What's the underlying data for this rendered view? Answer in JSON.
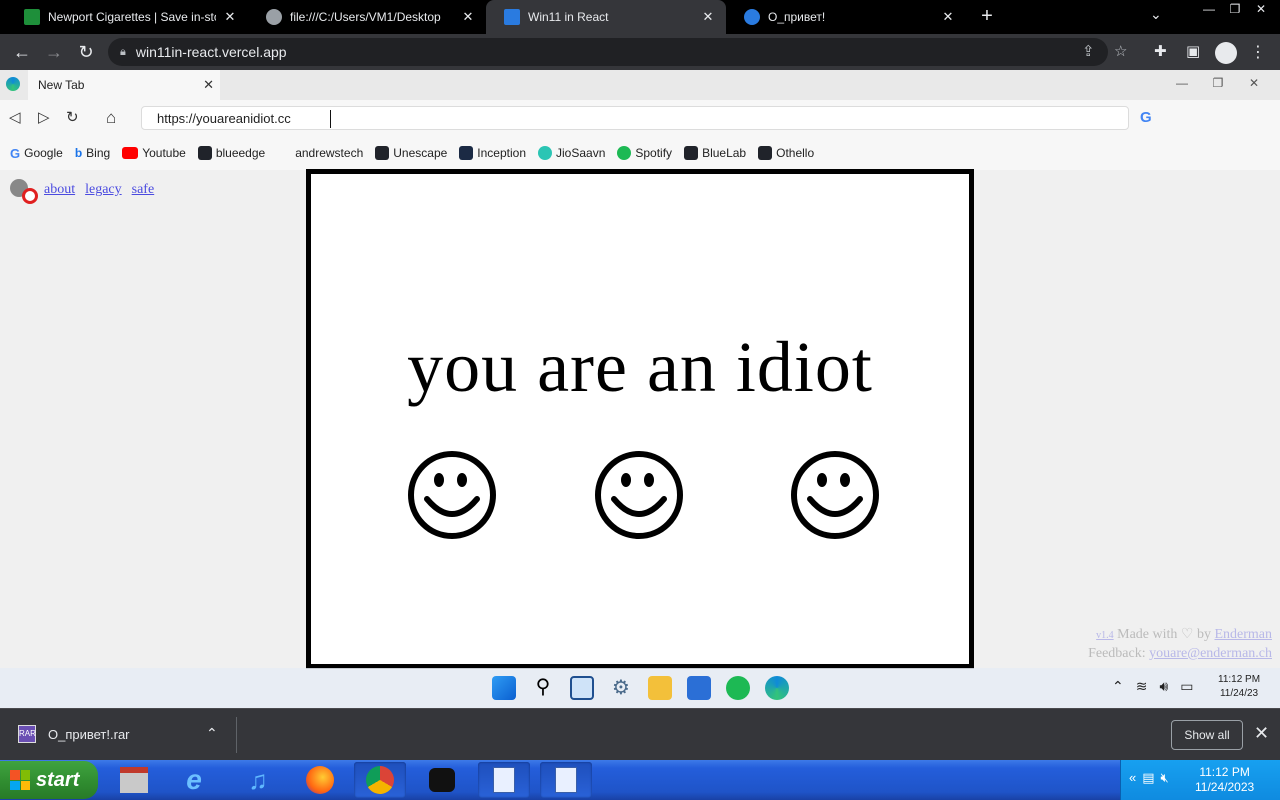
{
  "outer_tabs": [
    {
      "title": "Newport Cigarettes | Save in-store w",
      "color": "#1e8f3a"
    },
    {
      "title": "file:///C:/Users/VM1/Desktop",
      "color": "#9aa0a6"
    },
    {
      "title": "Win11 in React",
      "color": "#2a7be0"
    },
    {
      "title": "О_привет!",
      "color": "#2a7be0"
    }
  ],
  "outer_url": "win11in-react.vercel.app",
  "inner": {
    "tab_title": "New Tab",
    "address": "https://youareanidiot.cc",
    "bookmarks": [
      {
        "label": "Google",
        "icon": "google-icon",
        "color": "#4285f4"
      },
      {
        "label": "Bing",
        "icon": "bing-icon",
        "color": "#1a73e8"
      },
      {
        "label": "Youtube",
        "icon": "youtube-icon",
        "color": "#ff0000"
      },
      {
        "label": "blueedge",
        "icon": "react-icon",
        "color": "#20232a"
      },
      {
        "label": "andrewstech",
        "icon": "",
        "color": "#f7f7f7"
      },
      {
        "label": "Unescape",
        "icon": "react-icon",
        "color": "#20232a"
      },
      {
        "label": "Inception",
        "icon": "inception-icon",
        "color": "#1b2a44"
      },
      {
        "label": "JioSaavn",
        "icon": "jiosaavn-icon",
        "color": "#2bc5b4"
      },
      {
        "label": "Spotify",
        "icon": "spotify-icon",
        "color": "#1db954"
      },
      {
        "label": "BlueLab",
        "icon": "react-icon",
        "color": "#20232a"
      },
      {
        "label": "Othello",
        "icon": "react-icon",
        "color": "#20232a"
      }
    ],
    "links": {
      "about": "about",
      "legacy": "legacy",
      "safe": "safe"
    },
    "idiot_text": "you are an idiot",
    "credits": {
      "version": "v1.4",
      "made_with": " Made with",
      "heart": "♡",
      "by": " by ",
      "author": "Enderman",
      "feedback_label": "Feedback: ",
      "feedback_email": "youare@enderman.ch"
    },
    "taskbar_clock": {
      "time": "11:12 PM",
      "date": "11/24/23"
    }
  },
  "download": {
    "filename": "О_привет!.rar",
    "show_all": "Show all"
  },
  "xp": {
    "start_label": "start",
    "clock_time": "11:12 PM",
    "clock_date": "11/24/2023"
  }
}
